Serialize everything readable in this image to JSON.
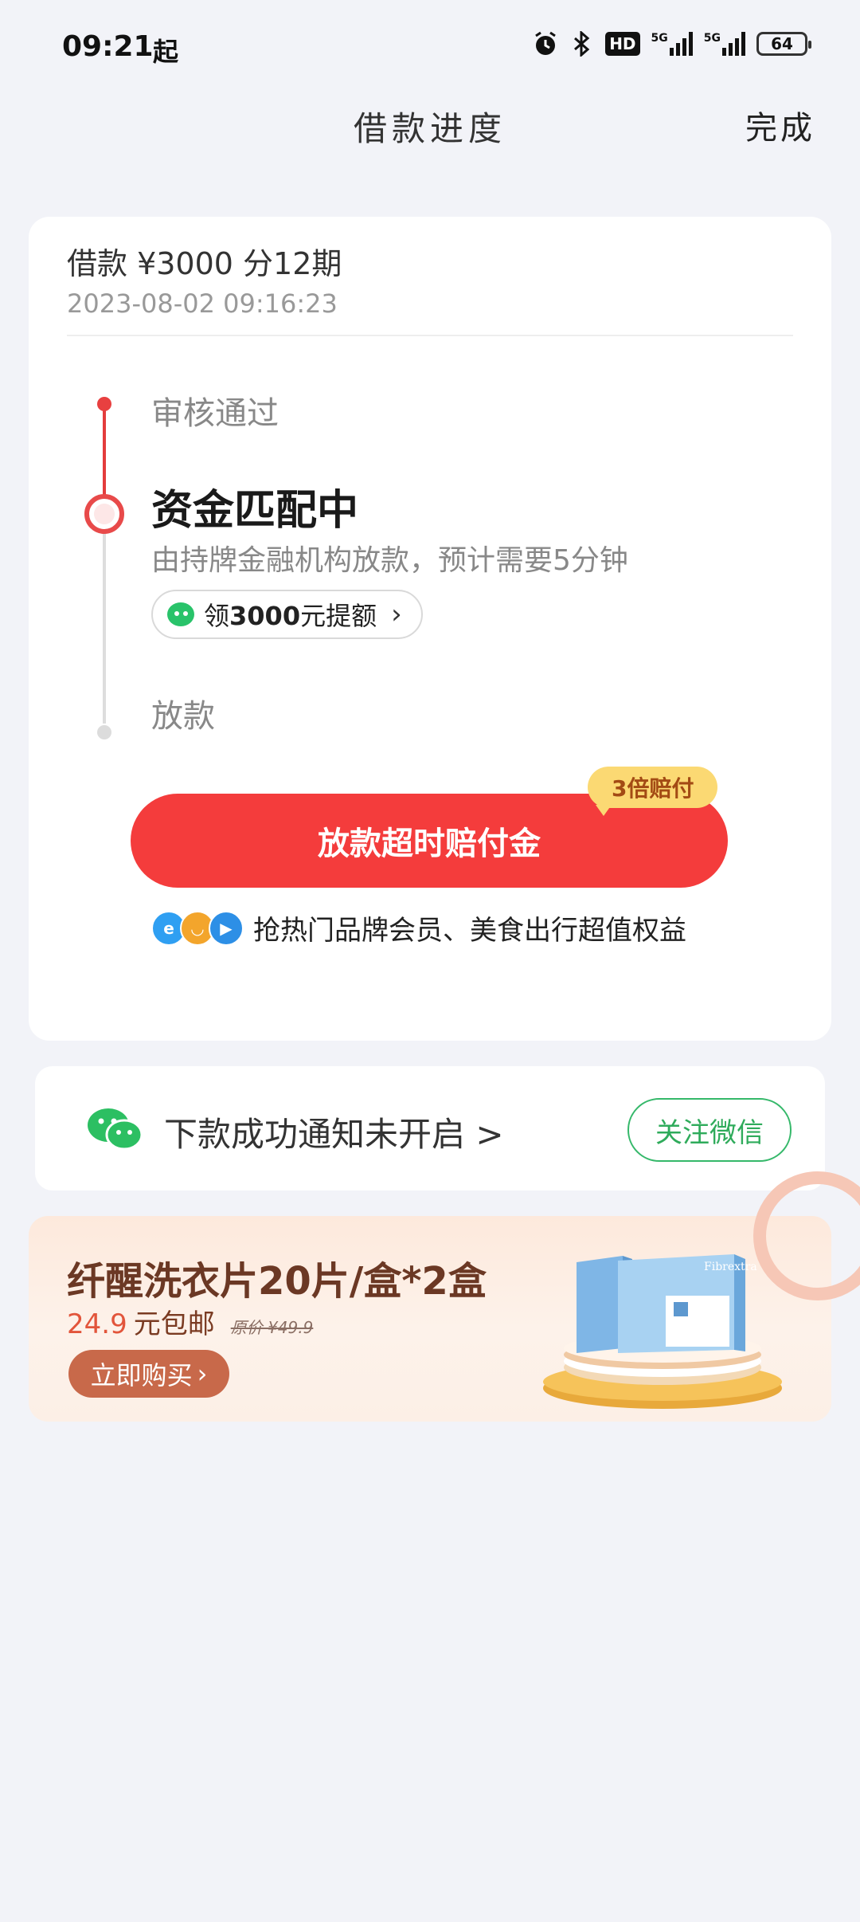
{
  "status_bar": {
    "time": "09:21",
    "extra_glyph": "起",
    "hd_label": "HD",
    "net1": "5G",
    "net2": "5G",
    "battery": "64"
  },
  "header": {
    "title": "借款进度",
    "done": "完成"
  },
  "loan": {
    "summary": "借款 ¥3000  分12期",
    "time": "2023-08-02 09:16:23"
  },
  "timeline": {
    "step1": "审核通过",
    "step2": "资金匹配中",
    "step2_desc": "由持牌金融机构放款，预计需要5分钟",
    "credit_pill": {
      "prefix": "领",
      "amount": "3000",
      "suffix": "元提额"
    },
    "step3": "放款"
  },
  "cta": {
    "label": "放款超时赔付金",
    "badge": "3倍赔付"
  },
  "perks": {
    "text": "抢热门品牌会员、美食出行超值权益"
  },
  "notify": {
    "text": "下款成功通知未开启 >",
    "button": "关注微信"
  },
  "ad": {
    "title": "纤醒洗衣片20片/盒*2盒",
    "price": "24.9",
    "price_suffix": "元包邮",
    "original_price": "原价 ¥49.9",
    "buy_button": "立即购买",
    "product_brand": "Fibrextra"
  },
  "colors": {
    "accent_red": "#f43c3c",
    "wechat_green": "#2fab5b",
    "badge_yellow": "#fbd973",
    "ad_brown": "#c8694a"
  }
}
